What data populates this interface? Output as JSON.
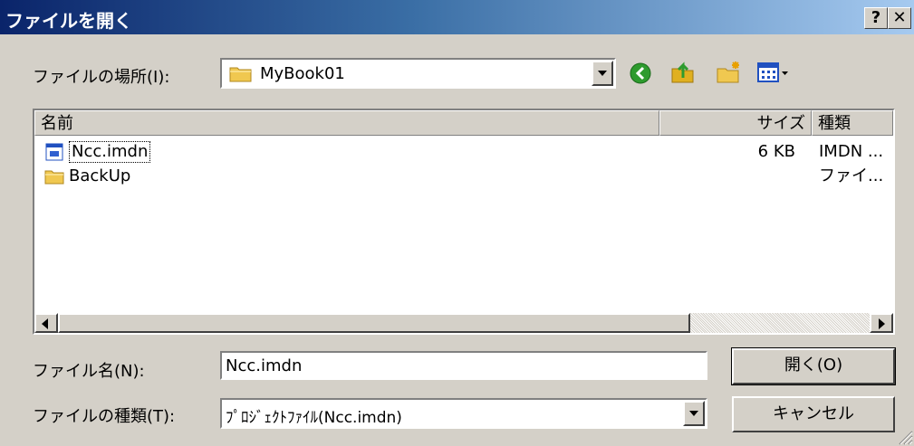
{
  "window": {
    "title": "ファイルを開く",
    "help_button": "?",
    "close_button": "✕"
  },
  "look_in": {
    "label": "ファイルの場所(I):",
    "value": "MyBook01"
  },
  "toolbar": {
    "icons": [
      "back-icon",
      "up-folder-icon",
      "new-folder-icon",
      "view-menu-icon"
    ],
    "colors": {
      "back": "#2e9b2e",
      "up": "#e0b020",
      "folder": "#f0c850",
      "view": "#2050c0"
    }
  },
  "file_list": {
    "columns": [
      "名前",
      "サイズ",
      "種類"
    ],
    "rows": [
      {
        "name": "Ncc.imdn",
        "size": "6 KB",
        "type": "IMDN ...",
        "icon": "file-icon"
      },
      {
        "name": "BackUp",
        "size": "",
        "type": "ファイ...",
        "icon": "folder-icon"
      }
    ]
  },
  "file_name": {
    "label": "ファイル名(N):",
    "value": "Ncc.imdn"
  },
  "file_type": {
    "label": "ファイルの種類(T):",
    "value": "ﾌﾟﾛｼﾞｪｸﾄﾌｧｲﾙ(Ncc.imdn)"
  },
  "buttons": {
    "open": "開く(O)",
    "cancel": "キャンセル"
  }
}
